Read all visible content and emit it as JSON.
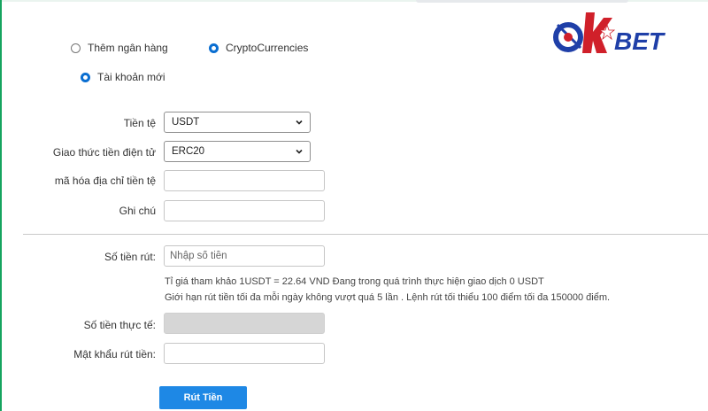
{
  "radios": {
    "add_bank": "Thêm ngân hàng",
    "crypto": "CryptoCurrencies",
    "new_account": "Tài khoản mới"
  },
  "logo": {
    "text_parts": [
      "O",
      "K",
      "BET"
    ],
    "colors": {
      "blue": "#1f3fa8",
      "red": "#d0202a",
      "white": "#ffffff"
    }
  },
  "form": {
    "currency": {
      "label": "Tiền tệ",
      "value": "USDT"
    },
    "protocol": {
      "label": "Giao thức tiền điện tử",
      "value": "ERC20"
    },
    "address": {
      "label": "mã hóa địa chỉ tiền tệ",
      "value": ""
    },
    "note": {
      "label": "Ghi chú",
      "value": ""
    }
  },
  "withdraw": {
    "amount": {
      "label": "Số tiền rút:",
      "placeholder": "Nhập số tiền"
    },
    "rate_text": "Tỉ giá tham khảo 1USDT = 22.64 VND Đang trong quá trình thực hiện giao dịch 0 USDT",
    "limit_text": "Giới hạn rút tiền tối đa mỗi ngày không vượt quá 5 lần . Lệnh rút tối thiểu 100 điểm tối đa 150000 điểm.",
    "actual": {
      "label": "Số tiền thực tế:"
    },
    "password": {
      "label": "Mật khẩu rút tiền:"
    },
    "submit": "Rút Tiền"
  },
  "colors": {
    "accent": "#1e88e5",
    "radio_checked": "#0a6ed1",
    "left_border": "#16a45f"
  }
}
